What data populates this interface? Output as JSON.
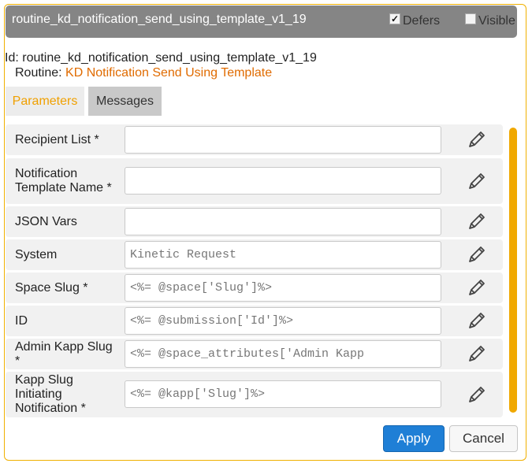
{
  "window": {
    "title": "routine_kd_notification_send_using_template_v1_19",
    "defers_label": "Defers",
    "defers_checked": true,
    "visible_label": "Visible",
    "visible_checked": false
  },
  "info": {
    "id_line": "Id: routine_kd_notification_send_using_template_v1_19",
    "routine_prefix": "Routine:",
    "routine_name": "KD Notification Send Using Template"
  },
  "tabs": [
    {
      "label": "Parameters",
      "active": true
    },
    {
      "label": "Messages",
      "active": false
    }
  ],
  "parameters": [
    {
      "label": "Recipient List *",
      "value": ""
    },
    {
      "label": "Notification Template Name *",
      "value": ""
    },
    {
      "label": "JSON Vars",
      "value": ""
    },
    {
      "label": "System",
      "value": "Kinetic Request"
    },
    {
      "label": "Space Slug *",
      "value": "<%= @space['Slug']%>"
    },
    {
      "label": "ID",
      "value": "<%= @submission['Id']%>"
    },
    {
      "label": "Admin Kapp Slug *",
      "value": "<%= @space_attributes['Admin Kapp"
    },
    {
      "label": "Kapp Slug Initiating Notification *",
      "value": "<%= @kapp['Slug']%>"
    }
  ],
  "buttons": {
    "apply": "Apply",
    "cancel": "Cancel"
  },
  "colors": {
    "accent": "#f0a800",
    "link": "#e06b00",
    "primary": "#1f7fd6",
    "titlebar": "#858585"
  },
  "icons": {
    "edit": "pencil-icon"
  }
}
